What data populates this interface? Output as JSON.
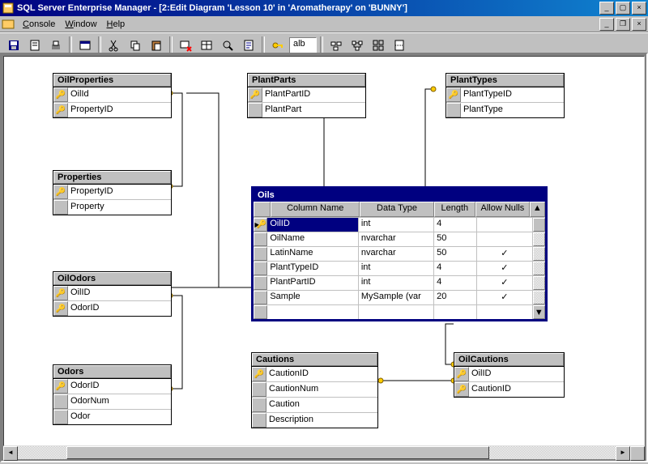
{
  "window": {
    "title": "SQL Server Enterprise Manager - [2:Edit Diagram 'Lesson 10' in 'Aromatherapy' on 'BUNNY']"
  },
  "menu": {
    "console": "Console",
    "window": "Window",
    "help": "Help"
  },
  "toolbar": {
    "alb_text": "alb"
  },
  "tables": {
    "OilProperties": {
      "title": "OilProperties",
      "cols": [
        {
          "name": "OilId",
          "pk": true
        },
        {
          "name": "PropertyID",
          "pk": true
        }
      ]
    },
    "Properties": {
      "title": "Properties",
      "cols": [
        {
          "name": "PropertyID",
          "pk": true
        },
        {
          "name": "Property",
          "pk": false
        }
      ]
    },
    "OilOdors": {
      "title": "OilOdors",
      "cols": [
        {
          "name": "OilID",
          "pk": true
        },
        {
          "name": "OdorID",
          "pk": true
        }
      ]
    },
    "Odors": {
      "title": "Odors",
      "cols": [
        {
          "name": "OdorID",
          "pk": true
        },
        {
          "name": "OdorNum",
          "pk": false
        },
        {
          "name": "Odor",
          "pk": false
        }
      ]
    },
    "PlantParts": {
      "title": "PlantParts",
      "cols": [
        {
          "name": "PlantPartID",
          "pk": true
        },
        {
          "name": "PlantPart",
          "pk": false
        }
      ]
    },
    "PlantTypes": {
      "title": "PlantTypes",
      "cols": [
        {
          "name": "PlantTypeID",
          "pk": true
        },
        {
          "name": "PlantType",
          "pk": false
        }
      ]
    },
    "Cautions": {
      "title": "Cautions",
      "cols": [
        {
          "name": "CautionID",
          "pk": true
        },
        {
          "name": "CautionNum",
          "pk": false
        },
        {
          "name": "Caution",
          "pk": false
        },
        {
          "name": "Description",
          "pk": false
        }
      ]
    },
    "OilCautions": {
      "title": "OilCautions",
      "cols": [
        {
          "name": "OilID",
          "pk": true
        },
        {
          "name": "CautionID",
          "pk": true
        }
      ]
    }
  },
  "oils": {
    "title": "Oils",
    "headers": {
      "col": "Column Name",
      "type": "Data Type",
      "len": "Length",
      "null": "Allow Nulls"
    },
    "rows": [
      {
        "name": "OilID",
        "type": "int",
        "len": "4",
        "null": false,
        "pk": true,
        "cur": true
      },
      {
        "name": "OilName",
        "type": "nvarchar",
        "len": "50",
        "null": false
      },
      {
        "name": "LatinName",
        "type": "nvarchar",
        "len": "50",
        "null": true
      },
      {
        "name": "PlantTypeID",
        "type": "int",
        "len": "4",
        "null": true
      },
      {
        "name": "PlantPartID",
        "type": "int",
        "len": "4",
        "null": true
      },
      {
        "name": "Sample",
        "type": "MySample (var",
        "len": "20",
        "null": true
      }
    ]
  }
}
